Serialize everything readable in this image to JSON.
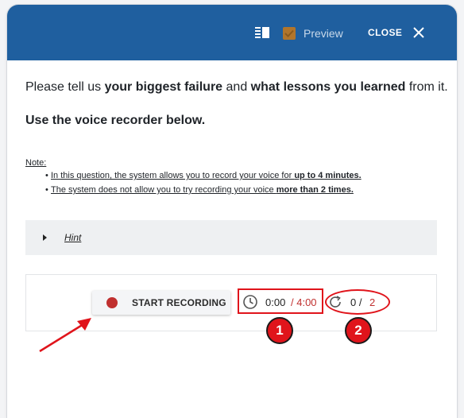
{
  "header": {
    "preview_label": "Preview",
    "preview_checked": true,
    "close_label": "CLOSE",
    "background_color": "#1f5f9f"
  },
  "question": {
    "part1": "Please tell us ",
    "bold1": "your biggest failure",
    "part2": " and ",
    "bold2": "what lessons you learned",
    "part3": " from it."
  },
  "instruction": "Use the voice recorder below.",
  "note": {
    "label": "Note:",
    "items": [
      {
        "text": "In this question, the system allows you to record your voice for ",
        "bold": "up to 4 minutes."
      },
      {
        "text": "The system does not allow you to try recording your voice ",
        "bold": "more than 2 times."
      }
    ]
  },
  "hint": {
    "label": "Hint"
  },
  "recorder": {
    "start_label": "START RECORDING",
    "elapsed": "0:00",
    "limit": "/ 4:00",
    "attempts_used": "0 /",
    "attempts_max": "2",
    "accent_color": "#c0302f"
  },
  "annotations": {
    "badge1": "1",
    "badge2": "2",
    "highlight_color": "#e0141b"
  }
}
